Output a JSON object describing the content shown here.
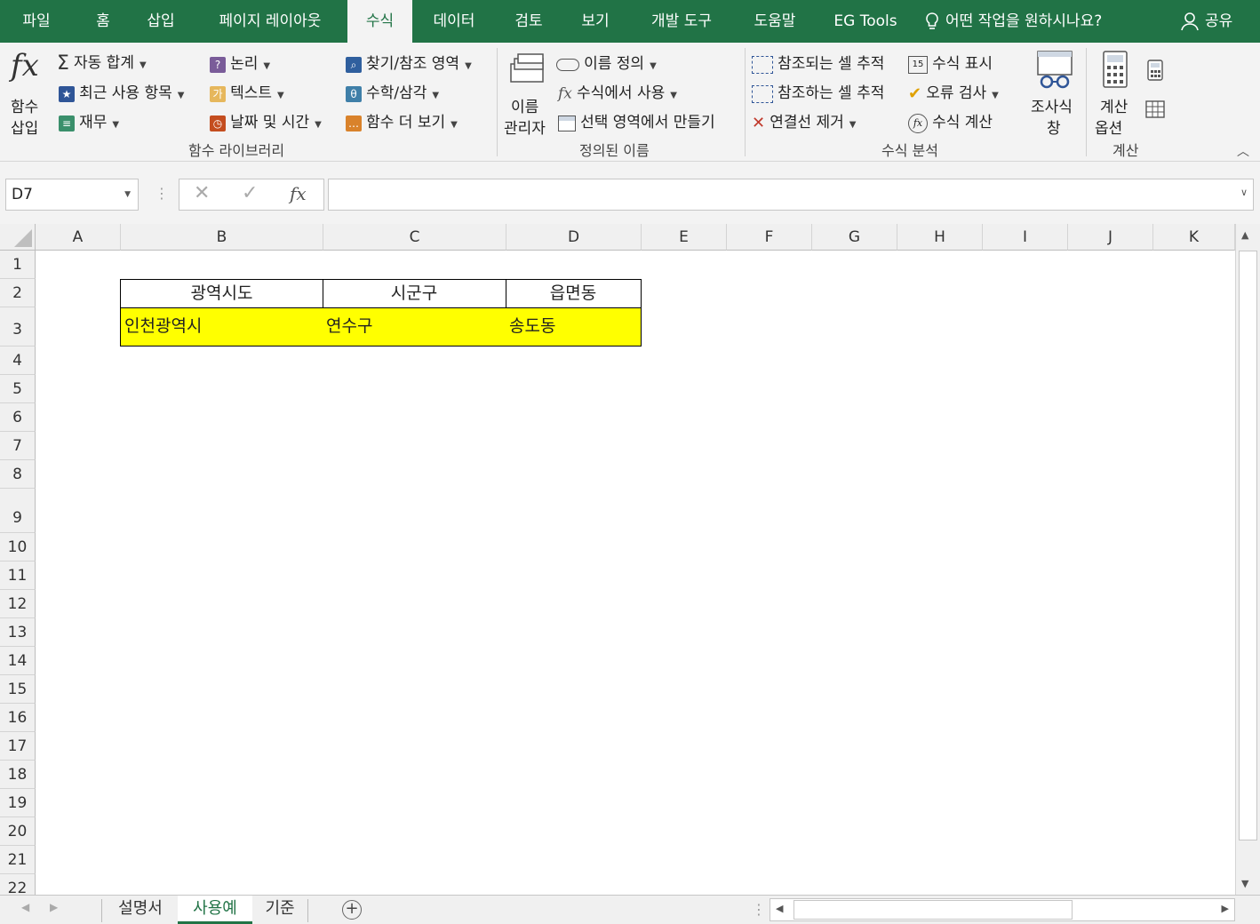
{
  "menu": {
    "tabs": [
      "파일",
      "홈",
      "삽입",
      "페이지 레이아웃",
      "수식",
      "데이터",
      "검토",
      "보기",
      "개발 도구",
      "도움말",
      "EG Tools"
    ],
    "active_tab": "수식",
    "tell_me": "어떤 작업을 원하시나요?",
    "share": "공유"
  },
  "ribbon": {
    "function_library": {
      "insert_function": [
        "함수",
        "삽입"
      ],
      "autosum": "자동 합계",
      "recent": "최근 사용 항목",
      "financial": "재무",
      "logical": "논리",
      "text": "텍스트",
      "datetime": "날짜 및 시간",
      "lookup": "찾기/참조 영역",
      "math": "수학/삼각",
      "more": "함수 더 보기",
      "group_label": "함수 라이브러리"
    },
    "defined_names": {
      "name_manager": [
        "이름",
        "관리자"
      ],
      "define_name": "이름 정의",
      "use_in_formula": "수식에서 사용",
      "create_from_selection": "선택 영역에서 만들기",
      "group_label": "정의된 이름"
    },
    "formula_auditing": {
      "trace_precedents": "참조되는 셀 추적",
      "trace_dependents": "참조하는 셀 추적",
      "remove_arrows": "연결선 제거",
      "show_formulas": "수식 표시",
      "error_checking": "오류 검사",
      "evaluate_formula": "수식 계산",
      "watch_window": [
        "조사식",
        "창"
      ],
      "group_label": "수식 분석"
    },
    "calculation": {
      "options": [
        "계산",
        "옵션"
      ],
      "group_label": "계산"
    }
  },
  "formula_bar": {
    "name_box": "D7",
    "fx": "fx",
    "formula": ""
  },
  "columns": [
    "A",
    "B",
    "C",
    "D",
    "E",
    "F",
    "G",
    "H",
    "I",
    "J",
    "K"
  ],
  "rows": [
    "1",
    "2",
    "3",
    "4",
    "5",
    "6",
    "7",
    "8",
    "9",
    "10",
    "11",
    "12",
    "13",
    "14",
    "15",
    "16",
    "17",
    "18",
    "19",
    "20",
    "21",
    "22"
  ],
  "table": {
    "headers": [
      "광역시도",
      "시군구",
      "읍면동"
    ],
    "values": [
      "인천광역시",
      "연수구",
      "송도동"
    ],
    "fill_color": "#ffff00"
  },
  "sheets": [
    "설명서",
    "사용예",
    "기준"
  ],
  "active_sheet": "사용예"
}
